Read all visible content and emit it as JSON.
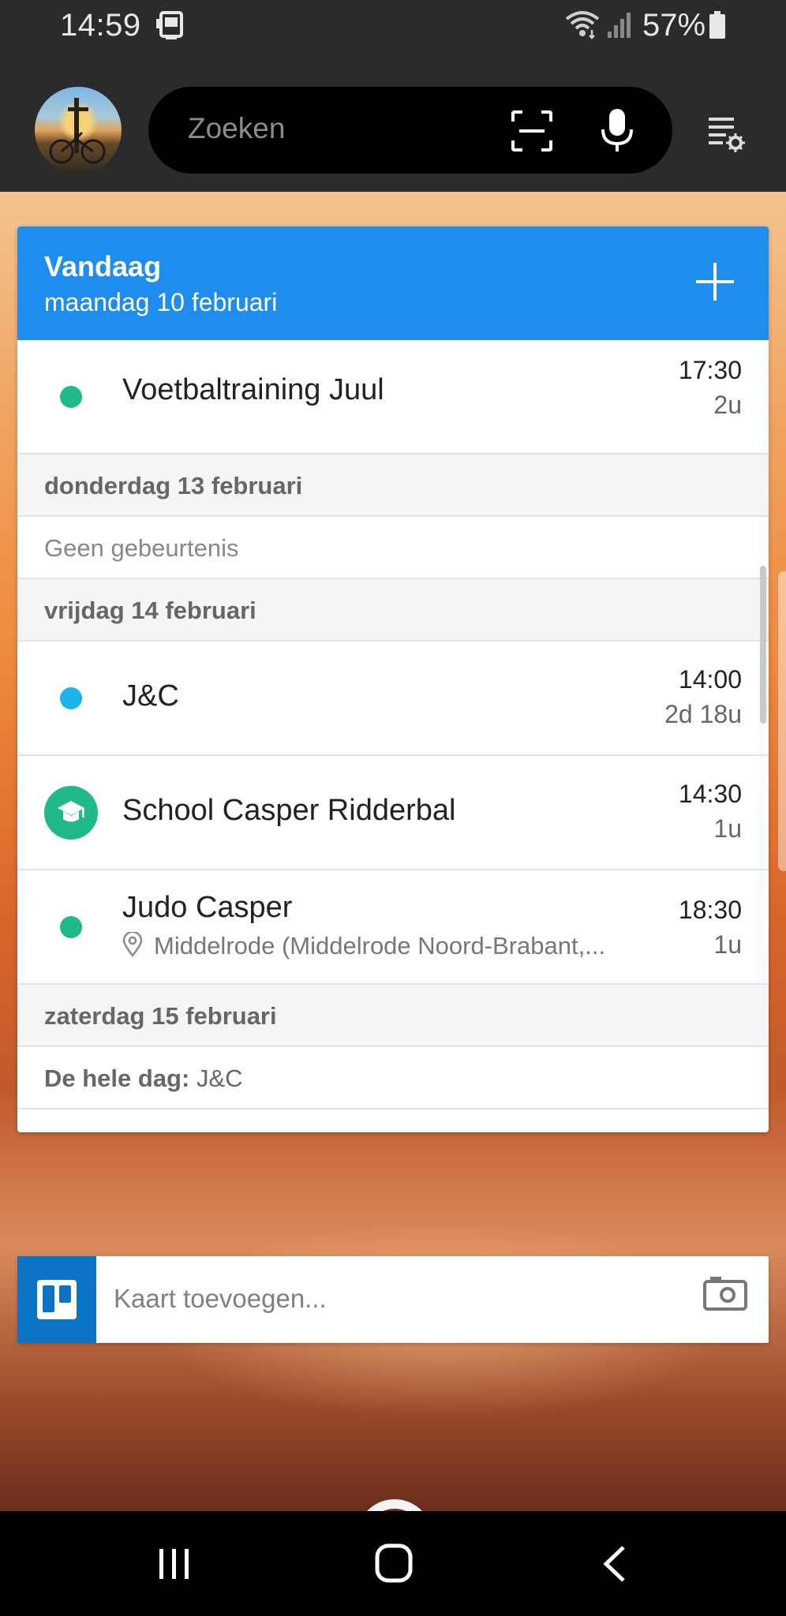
{
  "status_bar": {
    "time": "14:59",
    "battery": "57%",
    "icons": [
      "phone-icon",
      "wifi-icon",
      "signal-icon",
      "battery-icon"
    ]
  },
  "header": {
    "search_placeholder": "Zoeken",
    "icons": [
      "avatar",
      "scan-icon",
      "mic-icon",
      "settings-icon"
    ]
  },
  "calendar": {
    "title": "Vandaag",
    "subtitle": "maandag 10 februari",
    "accent_color": "#1e8ded",
    "rows": [
      {
        "type": "event",
        "title": "Voetbaltraining Juul",
        "time": "17:30",
        "duration": "2u",
        "dot_color": "#1fb98a"
      },
      {
        "type": "day",
        "label": "donderdag 13 februari"
      },
      {
        "type": "empty",
        "label": "Geen gebeurtenis"
      },
      {
        "type": "day",
        "label": "vrijdag 14 februari"
      },
      {
        "type": "event",
        "title": "J&C",
        "time": "14:00",
        "duration": "2d 18u",
        "dot_color": "#1bb3ee"
      },
      {
        "type": "event",
        "title": "School Casper Ridderbal",
        "time": "14:30",
        "duration": "1u",
        "badge": "school-icon",
        "dot_color": "#20b98a"
      },
      {
        "type": "event",
        "title": "Judo Casper",
        "location": "Middelrode (Middelrode Noord-Brabant,...",
        "time": "18:30",
        "duration": "1u",
        "dot_color": "#1fb98a"
      },
      {
        "type": "day",
        "label": "zaterdag 15 februari"
      },
      {
        "type": "allday",
        "prefix": "De hele dag:",
        "title": "J&C"
      }
    ]
  },
  "trello": {
    "placeholder": "Kaart toevoegen...",
    "brand_color": "#0b74c4"
  },
  "nav_bar": {
    "icons": [
      "recent-apps-icon",
      "home-icon",
      "back-icon"
    ]
  }
}
